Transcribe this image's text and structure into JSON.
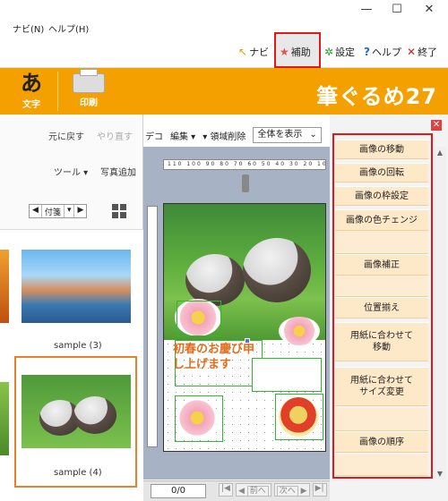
{
  "window": {
    "min_icon": "—",
    "max_icon": "☐",
    "close_icon": "✕"
  },
  "menu": {
    "items": [
      "ナビ(N)",
      "ヘルプ(H)"
    ]
  },
  "nav": {
    "navi": "ナビ",
    "hojo": "補助",
    "settei": "設定",
    "help": "ヘルプ",
    "exit": "終了"
  },
  "ribbon": {
    "moji_label": "文字",
    "moji_glyph": "あ",
    "print_label": "印刷",
    "brand": "筆ぐるめ27"
  },
  "left": {
    "undo": "元に戻す",
    "redo": "やり直す",
    "tool": "ツール",
    "add_photo": "写真追加",
    "pager_label": "付箋",
    "thumbs": [
      "sample (3)",
      "sample (4)"
    ]
  },
  "center": {
    "fragment": "デコ",
    "edit": "編集",
    "area_delete": "領域削除",
    "view_select": "全体を表示",
    "ruler": "110 100 90 80 70 60 50 40 30 20 10",
    "handwriting": "初春のお慶び申し上げます",
    "page": "0/0",
    "prev": "前へ",
    "next": "次へ"
  },
  "right_menu": {
    "items": [
      "画像の移動",
      "画像の回転",
      "画像の枠設定",
      "画像の色チェンジ",
      "画像補正",
      "位置揃え",
      "用紙に合わせて\n移動",
      "用紙に合わせて\nサイズ変更",
      "画像の順序"
    ]
  },
  "colors": {
    "ribbon": "#f3a000",
    "highlight": "#e01818",
    "menu_item_bg": "#fde8c8",
    "selection": "#e8812a"
  }
}
